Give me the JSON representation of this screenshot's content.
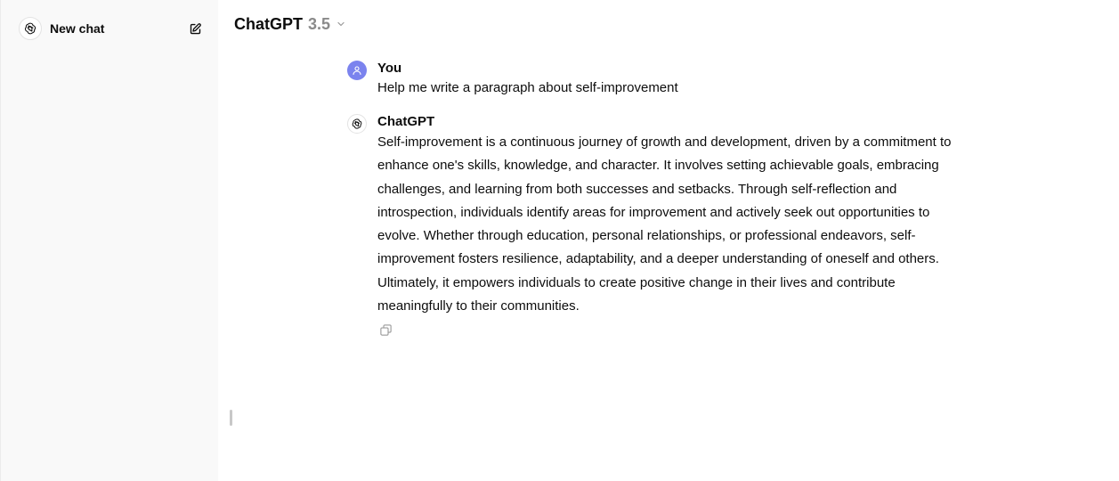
{
  "sidebar": {
    "new_chat_label": "New chat",
    "logo_icon": "openai-logo-icon",
    "edit_icon": "new-chat-edit-icon"
  },
  "header": {
    "model_name": "ChatGPT",
    "model_version": "3.5",
    "dropdown_icon": "chevron-down-icon"
  },
  "conversation": {
    "messages": [
      {
        "author": "You",
        "avatar_icon": "user-icon",
        "text": "Help me write a paragraph about self-improvement"
      },
      {
        "author": "ChatGPT",
        "avatar_icon": "openai-logo-icon",
        "text": "Self-improvement is a continuous journey of growth and development, driven by a commitment to enhance one's skills, knowledge, and character. It involves setting achievable goals, embracing challenges, and learning from both successes and setbacks. Through self-reflection and introspection, individuals identify areas for improvement and actively seek out opportunities to evolve. Whether through education, personal relationships, or professional endeavors, self-improvement fosters resilience, adaptability, and a deeper understanding of oneself and others. Ultimately, it empowers individuals to create positive change in their lives and contribute meaningfully to their communities.",
        "action_icon": "copy-icon"
      }
    ]
  },
  "colors": {
    "sidebar_bg": "#f9f9f9",
    "user_avatar": "#7b83ee",
    "model_version": "#8a8a8a"
  }
}
